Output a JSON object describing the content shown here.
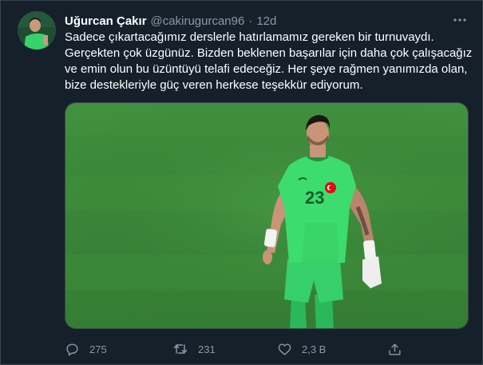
{
  "author": {
    "name": "Uğurcan Çakır",
    "handle": "@cakirugurcan96",
    "separator": "·",
    "time": "12d"
  },
  "tweet": {
    "lines": [
      "Sadece çıkartacağımız derslerle hatırlamamız gereken bir turnuvaydı.",
      "Gerçekten çok üzgünüz. Bizden beklenen başarılar için daha çok çalışacağız",
      "ve emin olun bu üzüntüyü telafi edeceğiz. Her şeye rağmen yanımızda olan,",
      "bize destekleriyle güç veren herkese teşekkür ediyorum."
    ]
  },
  "media": {
    "jersey_number": "23"
  },
  "actions": {
    "replies": "275",
    "retweets": "231",
    "likes": "2,3 B"
  },
  "icons": {
    "more": "more-horizontal-icon",
    "reply": "reply-icon",
    "retweet": "retweet-icon",
    "like": "heart-icon",
    "share": "share-icon"
  },
  "colors": {
    "background": "#15202b",
    "text": "#ffffff",
    "secondary": "#8899a6",
    "border": "#38444d",
    "pitch": "#3d8a3a",
    "jersey": "#3ddc6e"
  }
}
